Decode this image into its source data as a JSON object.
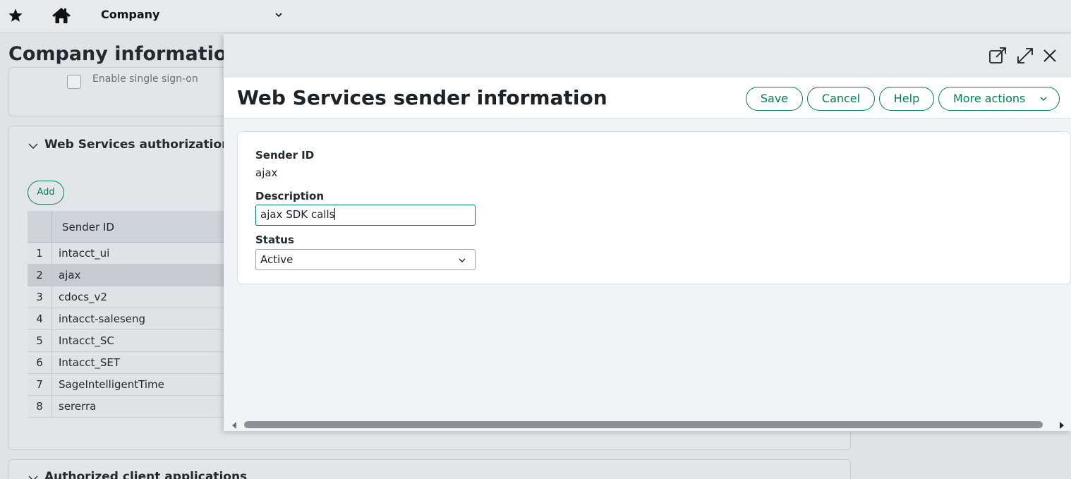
{
  "topbar": {
    "favorites_icon": "star-icon",
    "home_icon": "home-icon",
    "module_label": "Company"
  },
  "background_page": {
    "title": "Company information",
    "sso_label": "Enable single sign-on",
    "section_title": "Web Services authorizations",
    "add_label": "Add",
    "grid": {
      "column_header": "Sender ID",
      "rows": [
        {
          "num": "1",
          "sender_id": "intacct_ui"
        },
        {
          "num": "2",
          "sender_id": "ajax"
        },
        {
          "num": "3",
          "sender_id": "cdocs_v2"
        },
        {
          "num": "4",
          "sender_id": "intacct-saleseng"
        },
        {
          "num": "5",
          "sender_id": "Intacct_SC"
        },
        {
          "num": "6",
          "sender_id": "Intacct_SET"
        },
        {
          "num": "7",
          "sender_id": "SageIntelligentTime"
        },
        {
          "num": "8",
          "sender_id": "sererra"
        }
      ]
    },
    "next_section_title": "Authorized client applications"
  },
  "dialog": {
    "title": "Web Services sender information",
    "buttons": {
      "save": "Save",
      "cancel": "Cancel",
      "help": "Help",
      "more_actions": "More actions"
    },
    "form": {
      "sender_id_label": "Sender ID",
      "sender_id_value": "ajax",
      "description_label": "Description",
      "description_value": "ajax SDK calls",
      "status_label": "Status",
      "status_value": "Active"
    }
  },
  "colors": {
    "accent": "#00814b",
    "topbar": "#e6eaed",
    "overlay": "#dfe3e6"
  }
}
